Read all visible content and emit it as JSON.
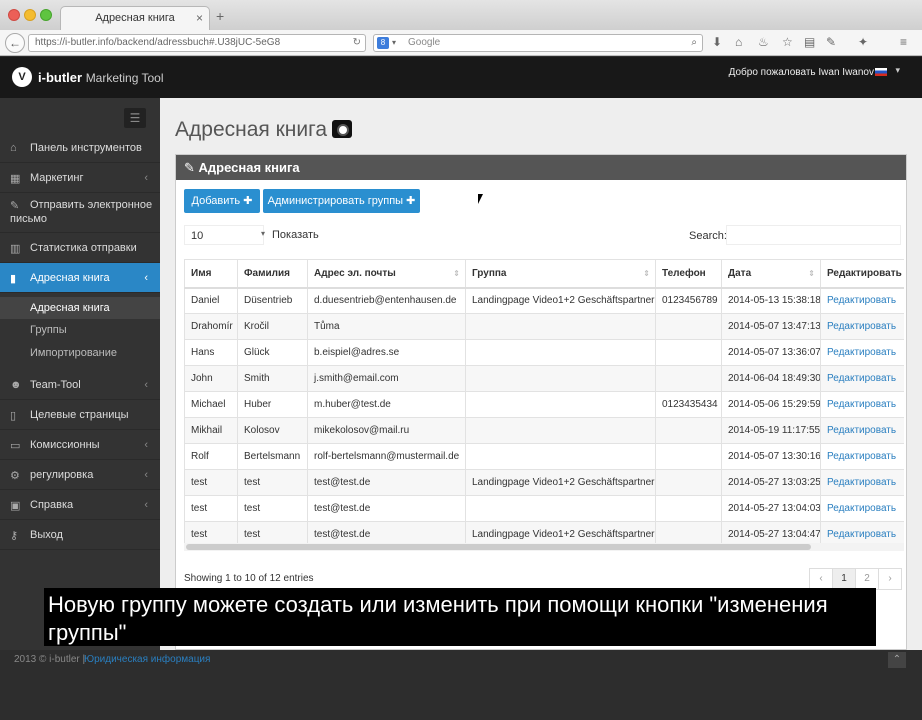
{
  "browser": {
    "tab_title": "Адресная книга",
    "tab_close": "×",
    "new_tab": "+",
    "back": "←",
    "url": "https://i-butler.info/backend/adressbuch#.U38jUC-5eG8",
    "search_engine": "8",
    "search_placeholder": "Google"
  },
  "app": {
    "logo_letter": "V",
    "brand_bold": "i-butler",
    "brand_rest": "Marketing Tool",
    "welcome": "Добро пожаловать Iwan Iwanov"
  },
  "sidebar": {
    "toggle": "☰",
    "items": [
      {
        "label": "Панель инструментов",
        "icon": "home-icon"
      },
      {
        "label": "Маркетинг",
        "icon": "film-icon"
      },
      {
        "label": "Отправить электронное",
        "label2": "письмо",
        "icon": "edit-icon"
      },
      {
        "label": "Статистика отправки",
        "icon": "bar-chart-icon"
      },
      {
        "label": "Адресная книга",
        "icon": "book-icon"
      },
      {
        "label": "Team-Tool",
        "icon": "users-icon"
      },
      {
        "label": "Целевые страницы",
        "icon": "pages-icon"
      },
      {
        "label": "Комиссионны",
        "icon": "money-icon"
      },
      {
        "label": "регулировка",
        "icon": "gears-icon"
      },
      {
        "label": "Справка",
        "icon": "help-icon"
      },
      {
        "label": "Выход",
        "icon": "key-icon"
      }
    ],
    "sub_items": [
      "Адресная книга",
      "Группы",
      "Импортирование"
    ]
  },
  "main": {
    "page_title": "Адресная книга",
    "panel_title": "Адресная книга",
    "add_button": "Добавить ✚",
    "groups_button": "Администрировать группы ✚",
    "length_value": "10",
    "length_label": "Показать",
    "search_label": "Search:",
    "info": "Showing 1 to 10 of 12 entries",
    "pagination": [
      "‹",
      "1",
      "2",
      "›"
    ]
  },
  "table": {
    "headers": [
      "Имя",
      "Фамилия",
      "Адрес эл. почты",
      "Группа",
      "Телефон",
      "Дата",
      "Редактировать"
    ],
    "rows": [
      [
        "Daniel",
        "Düsentrieb",
        "d.duesentrieb@entenhausen.de",
        "Landingpage Video1+2 Geschäftspartner",
        "0123456789",
        "2014-05-13 15:38:18",
        "Редактировать"
      ],
      [
        "Drahomír",
        "Kročil",
        "Tůma",
        "",
        "",
        "2014-05-07 13:47:13",
        "Редактировать"
      ],
      [
        "Hans",
        "Glück",
        "b.eispiel@adres.se",
        "",
        "",
        "2014-05-07 13:36:07",
        "Редактировать"
      ],
      [
        "John",
        "Smith",
        "j.smith@email.com",
        "",
        "",
        "2014-06-04 18:49:30",
        "Редактировать"
      ],
      [
        "Michael",
        "Huber",
        "m.huber@test.de",
        "",
        "0123435434",
        "2014-05-06 15:29:59",
        "Редактировать"
      ],
      [
        "Mikhail",
        "Kolosov",
        "mikekolosov@mail.ru",
        "",
        "",
        "2014-05-19 11:17:55",
        "Редактировать"
      ],
      [
        "Rolf",
        "Bertelsmann",
        "rolf-bertelsmann@mustermail.de",
        "",
        "",
        "2014-05-07 13:30:16",
        "Редактировать"
      ],
      [
        "test",
        "test",
        "test@test.de",
        "Landingpage Video1+2 Geschäftspartner",
        "",
        "2014-05-27 13:03:25",
        "Редактировать"
      ],
      [
        "test",
        "test",
        "test@test.de",
        "",
        "",
        "2014-05-27 13:04:03",
        "Редактировать"
      ],
      [
        "test",
        "test",
        "test@test.de",
        "Landingpage Video1+2 Geschäftspartner",
        "",
        "2014-05-27 13:04:47",
        "Редактировать"
      ]
    ]
  },
  "footer": {
    "copyright": "2013 © i-butler |",
    "link": "Юридическая информация",
    "to_top": "⌃"
  },
  "subtitle": "Новую группу можете создать или изменить при помощи кнопки \"изменения группы\""
}
